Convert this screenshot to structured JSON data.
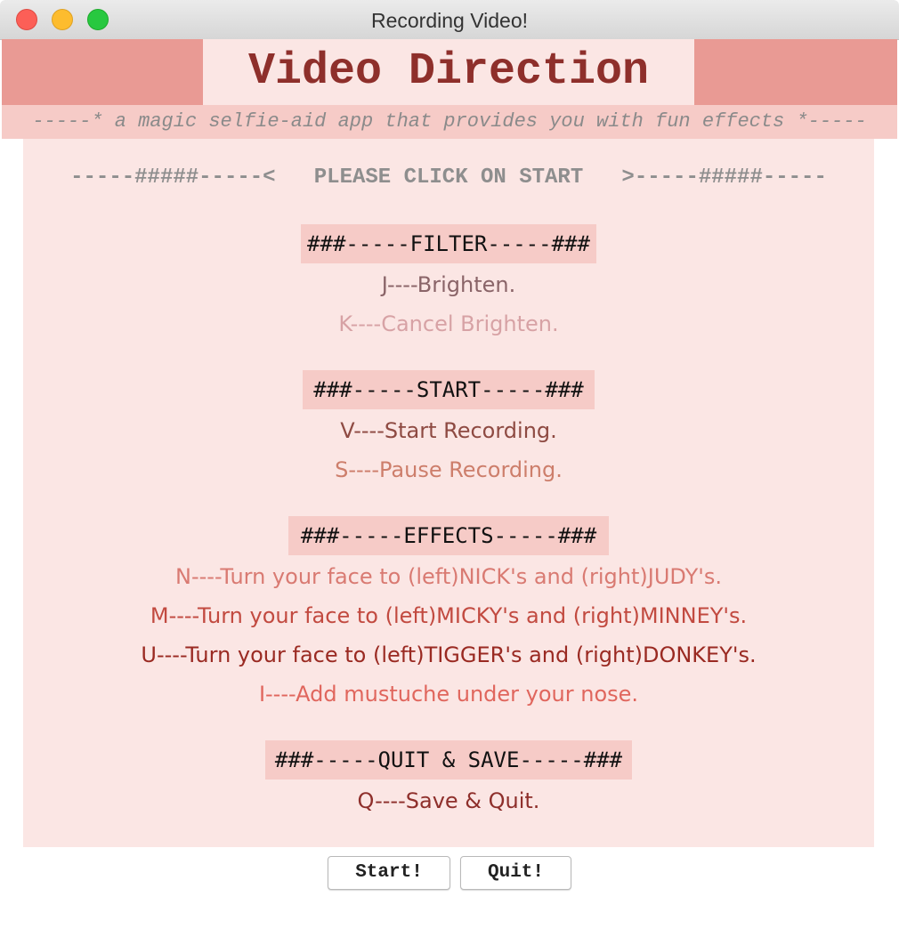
{
  "window": {
    "title": "Recording Video!"
  },
  "header": {
    "title": "Video Direction",
    "subtitle": "-----* a magic selfie-aid app that provides you with fun effects *-----"
  },
  "prompt": "-----#####-----<   PLEASE CLICK ON START   >-----#####-----",
  "sections": {
    "filter": {
      "heading": "###-----FILTER-----###",
      "items": [
        {
          "text": "J----Brighten.",
          "color": "#8a6468"
        },
        {
          "text": "K----Cancel Brighten.",
          "color": "#d7a2a5"
        }
      ]
    },
    "start": {
      "heading": "###-----START-----###",
      "items": [
        {
          "text": "V----Start Recording.",
          "color": "#8e4a42"
        },
        {
          "text": "S----Pause Recording.",
          "color": "#cd7e6b"
        }
      ]
    },
    "effects": {
      "heading": "###-----EFFECTS-----###",
      "items": [
        {
          "text": "N----Turn your face to (left)NICK's and (right)JUDY's.",
          "color": "#d97a72"
        },
        {
          "text": "M----Turn your face to (left)MICKY's and (right)MINNEY's.",
          "color": "#c24a40"
        },
        {
          "text": "U----Turn your face to (left)TIGGER's and (right)DONKEY's.",
          "color": "#9a2a22"
        },
        {
          "text": "I----Add mustuche under your nose.",
          "color": "#e0665d"
        }
      ]
    },
    "quit": {
      "heading": "###-----QUIT & SAVE-----###",
      "items": [
        {
          "text": "Q----Save & Quit.",
          "color": "#8e2f2b"
        }
      ]
    }
  },
  "buttons": {
    "start_label": "Start!",
    "quit_label": "Quit!"
  },
  "colors": {
    "header_band": "#e99a94",
    "title_bg": "#fbe6e4",
    "title_text": "#8e2f2b",
    "subtitle_bg": "#f6cbc7",
    "panel_bg": "#fbe6e4",
    "heading_bg": "#f6cbc7"
  }
}
